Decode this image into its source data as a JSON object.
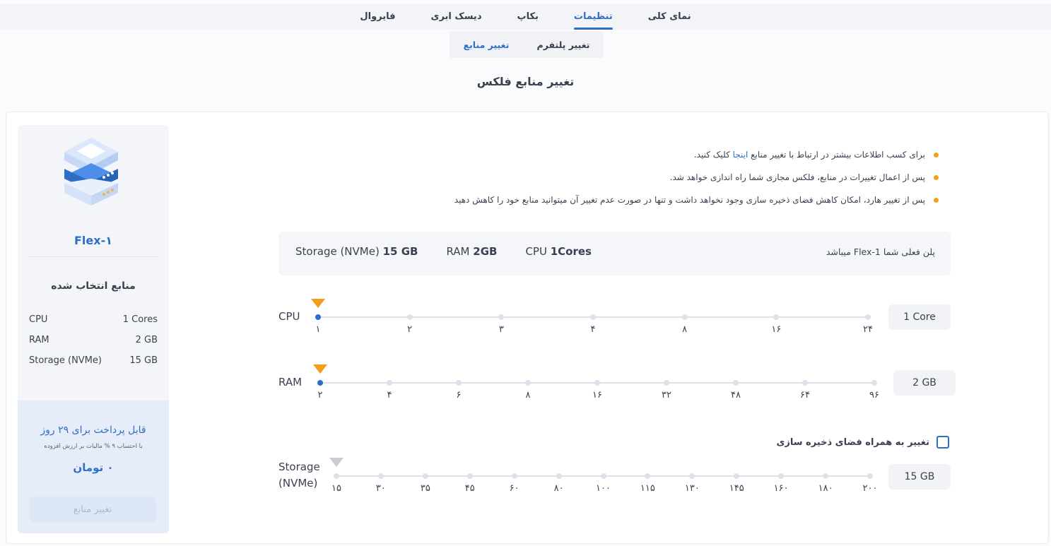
{
  "top_tabs": [
    {
      "label": "نمای کلی",
      "active": false
    },
    {
      "label": "تنظیمات",
      "active": true
    },
    {
      "label": "بکاپ",
      "active": false
    },
    {
      "label": "دیسک ابری",
      "active": false
    },
    {
      "label": "فایروال",
      "active": false
    }
  ],
  "sub_tabs": [
    {
      "label": "تغییر پلتفرم",
      "active": false
    },
    {
      "label": "تغییر منابع",
      "active": true
    }
  ],
  "page_title": "تغییر منابع فلکس",
  "side": {
    "plan_name": "Flex-۱",
    "selected_title": "منابع انتخاب شده",
    "specs": [
      {
        "name": "CPU",
        "value": "1 Cores"
      },
      {
        "name": "RAM",
        "value": "2 GB"
      },
      {
        "name": "Storage (NVMe)",
        "value": "15 GB"
      }
    ],
    "pay_title": "قابل پرداخت برای ۲۹ روز",
    "pay_note": "با احتساب ۹ % مالیات بر ارزش افزوده",
    "pay_price": "۰ تومان",
    "pay_button": "تغییر منابع"
  },
  "info": {
    "item1_before": "برای کسب اطلاعات بیشتر در ارتباط با تغییر منابع ",
    "item1_link": "اینجا",
    "item1_after": " کلیک کنید.",
    "item2": "پس از اعمال تغییرات در منابع، فلکس مجازی شما راه اندازی خواهد شد.",
    "item3": "پس از تغییر هارد، امکان کاهش فضای ذخیره سازی وجود نخواهد داشت و تنها در صورت عدم تغییر آن میتوانید منابع خود را کاهش دهید"
  },
  "current_plan": {
    "note": "پلن فعلی شما Flex-1 میباشد",
    "cpu_label": "CPU",
    "cpu_value": "1Cores",
    "ram_label": "RAM",
    "ram_value": "2GB",
    "storage_label": "Storage (NVMe)",
    "storage_value": "15 GB"
  },
  "sliders": {
    "cpu": {
      "label": "CPU",
      "value_display": "1 Core",
      "ticks": [
        "۱",
        "۲",
        "۳",
        "۴",
        "۸",
        "۱۶",
        "۲۴"
      ],
      "selected_index": 0
    },
    "ram": {
      "label": "RAM",
      "value_display": "2 GB",
      "ticks": [
        "۲",
        "۴",
        "۶",
        "۸",
        "۱۶",
        "۳۲",
        "۴۸",
        "۶۴",
        "۹۶"
      ],
      "selected_index": 0
    },
    "storage": {
      "label_line1": "Storage",
      "label_line2": "(NVMe)",
      "value_display": "15 GB",
      "ticks": [
        "۱۵",
        "۳۰",
        "۳۵",
        "۴۵",
        "۶۰",
        "۸۰",
        "۱۰۰",
        "۱۱۵",
        "۱۳۰",
        "۱۴۵",
        "۱۶۰",
        "۱۸۰",
        "۲۰۰"
      ],
      "selected_index": 0,
      "enabled": false
    }
  },
  "storage_checkbox": {
    "label": "تغییر به همراه فضای ذخیره سازی",
    "checked": false
  },
  "colors": {
    "accent": "#2f6ec6",
    "pointer_active": "#f49c1b",
    "pointer_disabled": "#c8ccd3",
    "bullet": "#f49c1b"
  }
}
